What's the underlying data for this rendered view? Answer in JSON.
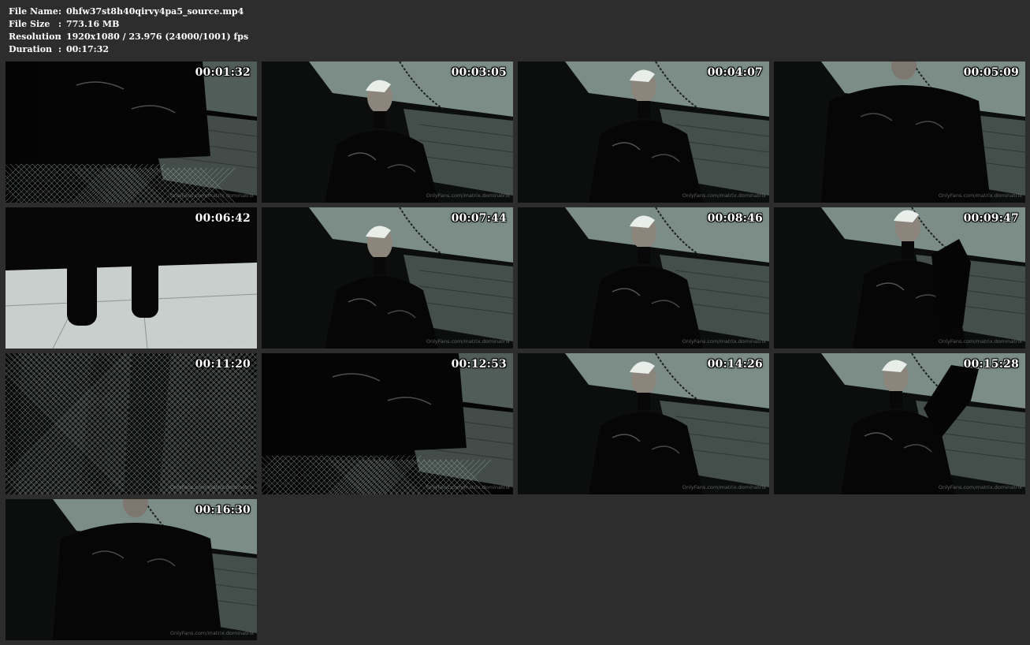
{
  "file_info": [
    {
      "label": "File Name",
      "value": "0hfw37st8h40qirvy4pa5_source.mp4"
    },
    {
      "label": "File Size",
      "value": "773.16 MB"
    },
    {
      "label": "Resolution",
      "value": "1920x1080 / 23.976 (24000/1001) fps"
    },
    {
      "label": "Duration",
      "value": "00:17:32"
    }
  ],
  "separator": ":",
  "watermark": "OnlyFans.com/matrix.dominatrix",
  "colors": {
    "background": "#2d2d2d",
    "text": "#ffffff",
    "scene_ceiling": "#8fa39c",
    "scene_wall": "#4f5956",
    "scene_floor": "#c8cfcc"
  },
  "thumbnails": [
    {
      "time": "00:01:32",
      "scene": "torso-fishnet"
    },
    {
      "time": "00:03:05",
      "scene": "standing-wide"
    },
    {
      "time": "00:04:07",
      "scene": "standing-close"
    },
    {
      "time": "00:05:09",
      "scene": "torso-high"
    },
    {
      "time": "00:06:42",
      "scene": "boots-floor"
    },
    {
      "time": "00:07:44",
      "scene": "standing-wide"
    },
    {
      "time": "00:08:46",
      "scene": "standing-close"
    },
    {
      "time": "00:09:47",
      "scene": "glove-gesture"
    },
    {
      "time": "00:11:20",
      "scene": "legs-dark"
    },
    {
      "time": "00:12:53",
      "scene": "torso-fishnet"
    },
    {
      "time": "00:14:26",
      "scene": "standing-close"
    },
    {
      "time": "00:15:28",
      "scene": "glove-reach"
    },
    {
      "time": "00:16:30",
      "scene": "torso-high"
    }
  ]
}
